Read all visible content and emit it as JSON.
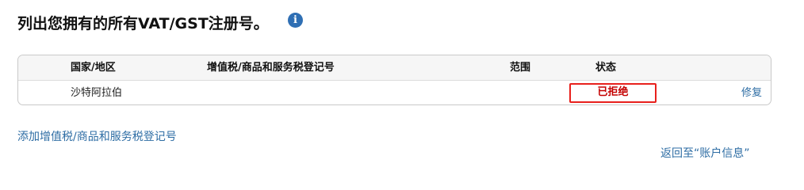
{
  "page": {
    "heading": "列出您拥有的所有VAT/GST注册号。",
    "info_icon": "info-icon",
    "info_glyph": "i"
  },
  "table": {
    "columns": {
      "country": "国家/地区",
      "reg_number": "增值税/商品和服务税登记号",
      "scope": "范围",
      "status": "状态"
    },
    "rows": [
      {
        "country": "沙特阿拉伯",
        "reg_number": "",
        "scope": "",
        "status": "已拒绝",
        "action": "修复"
      }
    ]
  },
  "links": {
    "add": "添加增值税/商品和服务税登记号",
    "back": "返回至“账户信息”"
  },
  "colors": {
    "link": "#2e6da4",
    "status_rejected": "#c40000",
    "highlight_box": "#e8201c",
    "info_icon": "#2f6fb4"
  }
}
